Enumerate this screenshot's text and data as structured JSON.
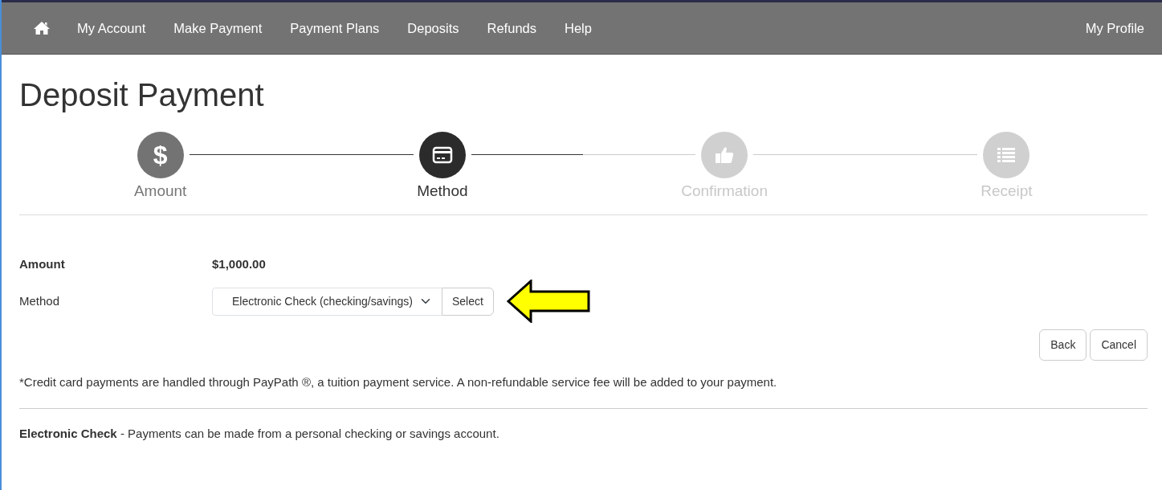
{
  "nav": {
    "items": [
      {
        "label": "My Account"
      },
      {
        "label": "Make Payment"
      },
      {
        "label": "Payment Plans"
      },
      {
        "label": "Deposits"
      },
      {
        "label": "Refunds"
      },
      {
        "label": "Help"
      }
    ],
    "profile": "My Profile"
  },
  "page_title": "Deposit Payment",
  "steps": [
    {
      "label": "Amount",
      "kind": "dollar",
      "glyph": "$",
      "completed": true,
      "selected": false
    },
    {
      "label": "Method",
      "kind": "card",
      "completed": false,
      "selected": true
    },
    {
      "label": "Confirmation",
      "kind": "thumb",
      "completed": false,
      "selected": false
    },
    {
      "label": "Receipt",
      "kind": "list",
      "completed": false,
      "selected": false
    }
  ],
  "form": {
    "amount_label": "Amount",
    "amount_value": "$1,000.00",
    "method_label": "Method",
    "method_value": "Electronic Check (checking/savings)",
    "select_button": "Select"
  },
  "buttons": [
    "Back",
    "Cancel"
  ],
  "note": "*Credit card payments are handled through PayPath ®, a tuition payment service. A non-refundable service fee will be added to your payment.",
  "method_note": "**Electronic Check** - Payments can be made from a personal checking or savings  account."
}
